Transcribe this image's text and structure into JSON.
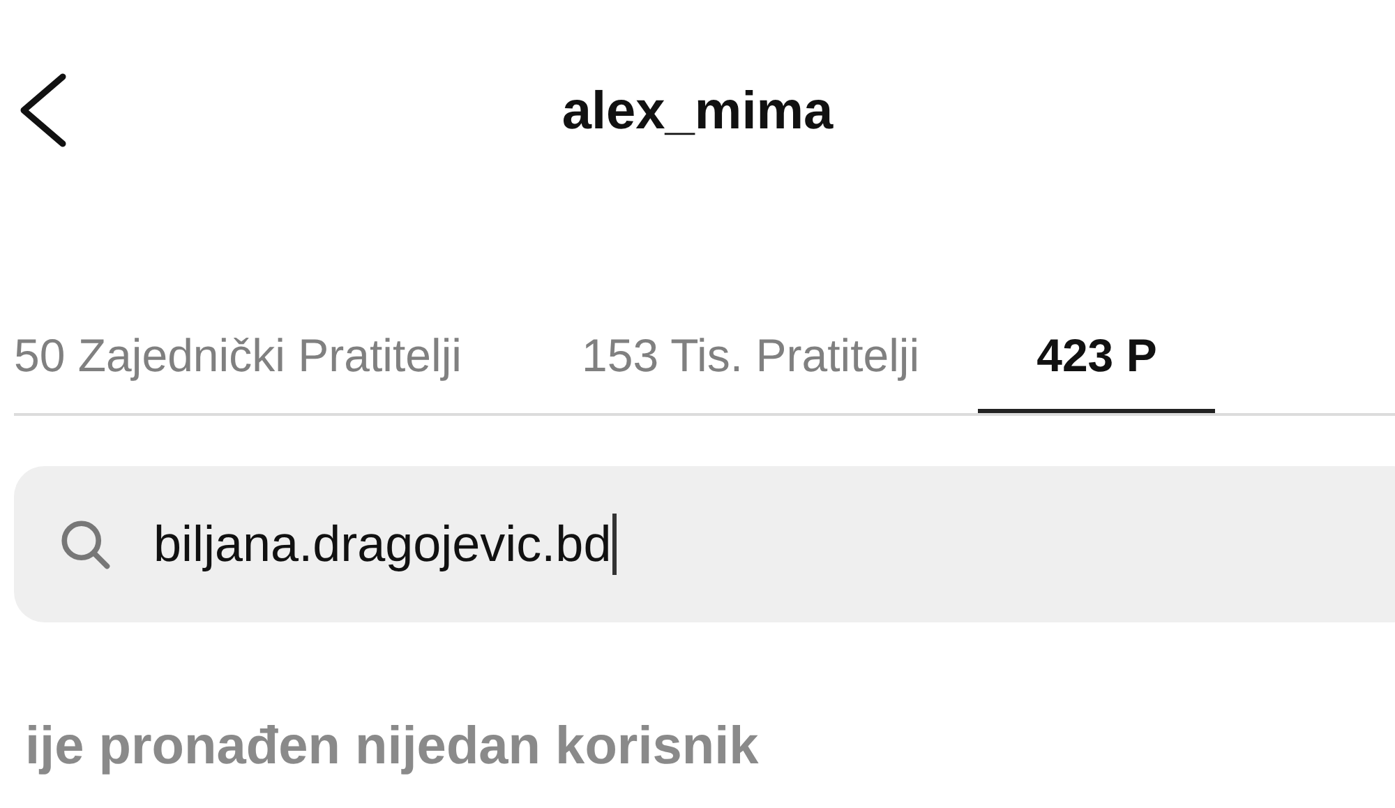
{
  "header": {
    "title": "alex_mima"
  },
  "tabs": [
    {
      "label": "50 Zajednički Pratitelji",
      "selected": false
    },
    {
      "label": "153 Tis. Pratitelji",
      "selected": false
    },
    {
      "label": "423 P",
      "selected": true
    }
  ],
  "search": {
    "value": "biljana.dragojevic.bd"
  },
  "message": "ije pronađen nijedan korisnik"
}
